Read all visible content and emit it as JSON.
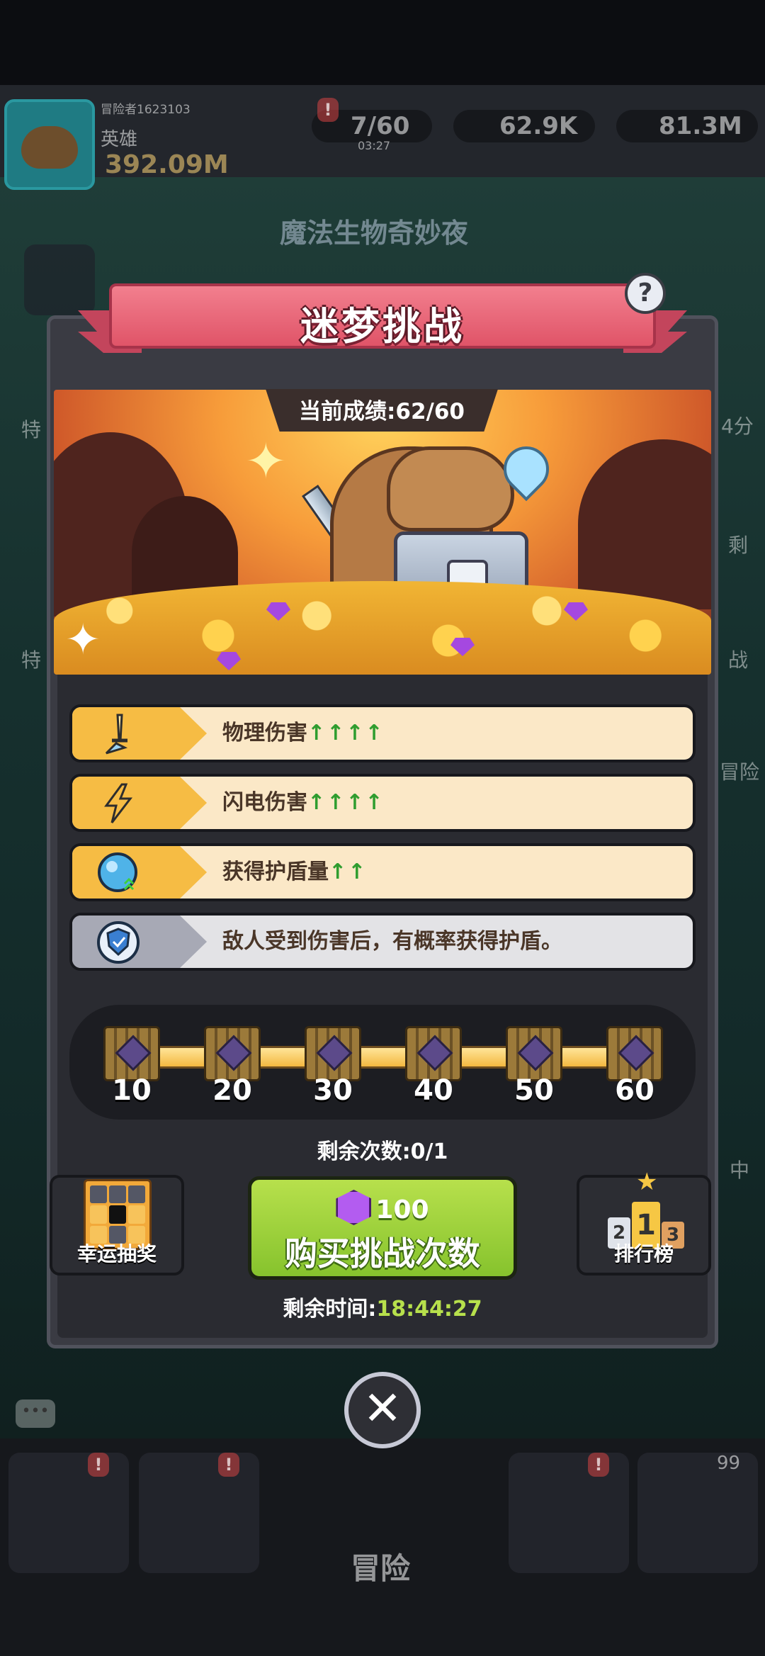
{
  "background": {
    "player_id": "冒险者1623103",
    "player_title": "英雄",
    "power": "392.09M",
    "energy": "7/60",
    "energy_timer": "03:27",
    "gems": "62.9K",
    "coins": "81.3M",
    "event_title": "魔法生物奇妙夜",
    "nav_adventure": "冒险",
    "badge_count": "99",
    "side_texts": [
      "特",
      "4分",
      "剩",
      "特",
      "战",
      "冒险",
      "中"
    ]
  },
  "modal": {
    "title": "迷梦挑战",
    "help_symbol": "?",
    "score_text": "当前成绩:62/60",
    "buffs": [
      {
        "icon": "sword-icon",
        "label": "物理伤害",
        "arrows": "↑↑↑↑",
        "style": "gold"
      },
      {
        "icon": "lightning-icon",
        "label": "闪电伤害",
        "arrows": "↑↑↑↑",
        "style": "gold"
      },
      {
        "icon": "shield-orb-icon",
        "label": "获得护盾量",
        "arrows": "↑↑",
        "style": "gold"
      },
      {
        "icon": "shield-icon",
        "label": "敌人受到伤害后，有概率获得护盾。",
        "arrows": "",
        "style": "grey"
      }
    ],
    "milestones": [
      "10",
      "20",
      "30",
      "40",
      "50",
      "60"
    ],
    "remaining_attempts": "剩余次数:0/1",
    "lucky_draw_label": "幸运抽奖",
    "buy_cost": "100",
    "buy_label": "购买挑战次数",
    "leaderboard_label": "排行榜",
    "leaderboard_ranks": [
      "2",
      "1",
      "3"
    ],
    "timer_label": "剩余时间:",
    "timer_value": "18:44:27",
    "close_symbol": "✕"
  },
  "colors": {
    "ribbon": "#e05468",
    "buy_button": "#86c32d",
    "timer_accent": "#b7e04c",
    "buff_gold": "#f6bc44",
    "arrow_green": "#2f9d2f"
  }
}
